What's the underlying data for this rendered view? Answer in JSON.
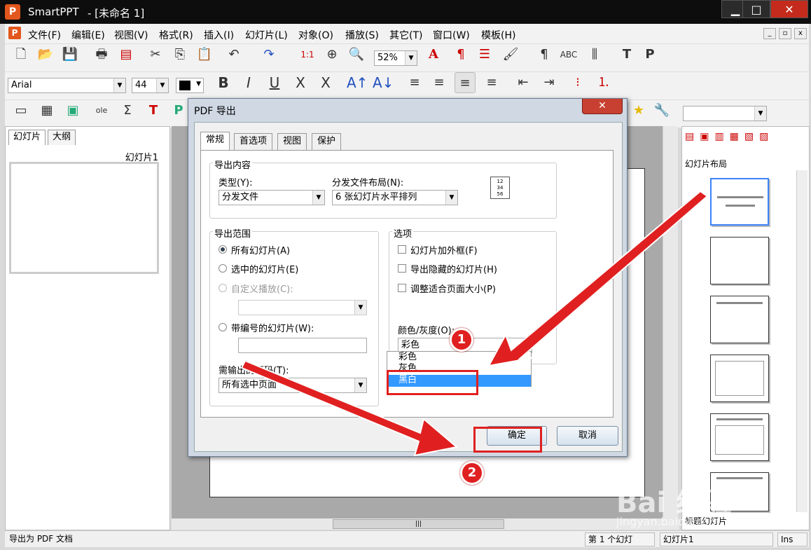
{
  "window": {
    "app_icon": "P",
    "app_name": "SmartPPT",
    "doc_title": "- [未命名 1]"
  },
  "menu": [
    "文件(F)",
    "编辑(E)",
    "视图(V)",
    "格式(R)",
    "插入(I)",
    "幻灯片(L)",
    "对象(O)",
    "播放(S)",
    "其它(T)",
    "窗口(W)",
    "模板(H)"
  ],
  "toolbar": {
    "zoom": "52%",
    "font": "Arial",
    "font_size": "44"
  },
  "left_panel": {
    "tab_slides": "幻灯片",
    "tab_outline": "大纲",
    "slide_label": "幻灯片1"
  },
  "right_panel": {
    "title": "幻灯片布局",
    "footer": "标题幻灯片"
  },
  "status": {
    "left": "导出为 PDF 文档",
    "slide": "第 1 个幻灯",
    "name": "幻灯片1",
    "mode": "Ins"
  },
  "dialog": {
    "title": "PDF 导出",
    "tabs": [
      "常规",
      "首选项",
      "视图",
      "保护"
    ],
    "export_content": "导出内容",
    "type_label": "类型(Y):",
    "type_value": "分发文件",
    "layout_label": "分发文件布局(N):",
    "layout_value": "6 张幻灯片水平排列",
    "range_label": "导出范围",
    "range_all": "所有幻灯片(A)",
    "range_selected": "选中的幻灯片(E)",
    "range_custom": "自定义播放(C):",
    "range_numbered": "带编号的幻灯片(W):",
    "pages_label": "需输出的页码(T):",
    "pages_value": "所有选中页面",
    "options_label": "选项",
    "opt_frame": "幻灯片加外框(F)",
    "opt_hidden": "导出隐藏的幻灯片(H)",
    "opt_fit": "调整适合页面大小(P)",
    "color_label": "颜色/灰度(O):",
    "color_value": "彩色",
    "color_options": [
      "彩色",
      "灰色",
      "黑白"
    ],
    "ok": "确定",
    "cancel": "取消"
  },
  "annotations": {
    "badge1": "1",
    "badge2": "2",
    "accent": "#e02020"
  },
  "watermark": {
    "logo": "Bai 经验",
    "url": "jingyan.baidu.com"
  }
}
